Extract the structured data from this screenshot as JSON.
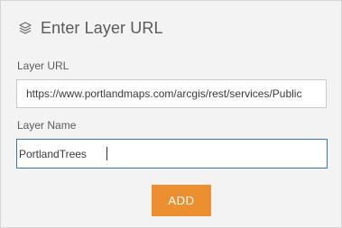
{
  "header": {
    "icon": "layers-icon",
    "title": "Enter Layer URL"
  },
  "form": {
    "url_label": "Layer URL",
    "url_value": "https://www.portlandmaps.com/arcgis/rest/services/Public",
    "name_label": "Layer Name",
    "name_value": "PortlandTrees"
  },
  "actions": {
    "add_label": "ADD"
  },
  "colors": {
    "accent": "#eb8f30",
    "focus_border": "#3a74a8",
    "panel_bg": "#f3f3f3"
  }
}
